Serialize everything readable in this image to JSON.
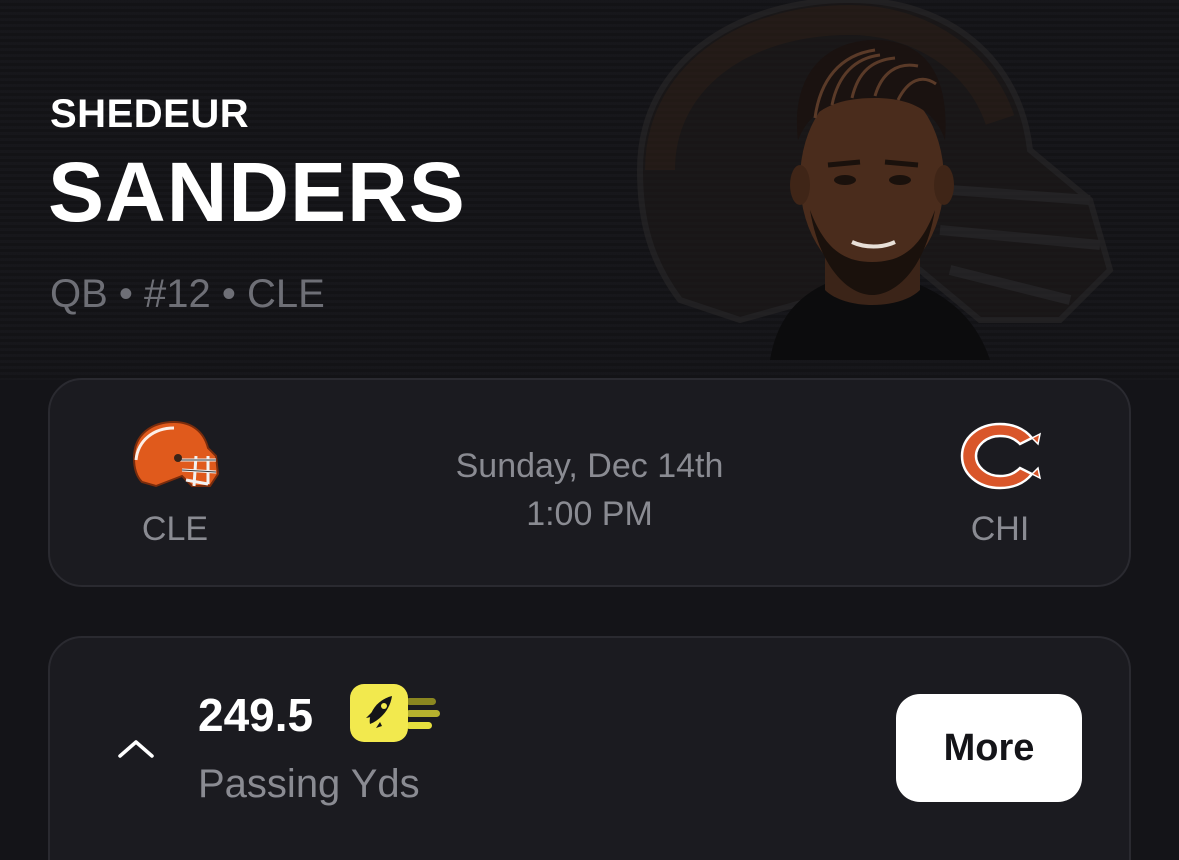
{
  "player": {
    "first_name": "SHEDEUR",
    "last_name": "SANDERS",
    "meta": "QB • #12 • CLE",
    "photo_icon": "player-headshot-with-team-helmet"
  },
  "game": {
    "home_team": {
      "abbr": "CLE",
      "icon": "browns-helmet-icon"
    },
    "away_team": {
      "abbr": "CHI",
      "icon": "bears-c-logo-icon"
    },
    "date": "Sunday, Dec 14th",
    "time": "1:00 PM"
  },
  "prop": {
    "line": "249.5",
    "stat": "Passing Yds",
    "boost_icon": "rocket-boost-icon",
    "more_label": "More",
    "toggle_icon": "chevron-up-icon"
  },
  "colors": {
    "background": "#141418",
    "card": "#1b1b20",
    "muted_text": "#8a8b92",
    "browns_orange": "#e05a1c",
    "bears_orange": "#d9562a",
    "boost_yellow": "#f2e94e"
  }
}
